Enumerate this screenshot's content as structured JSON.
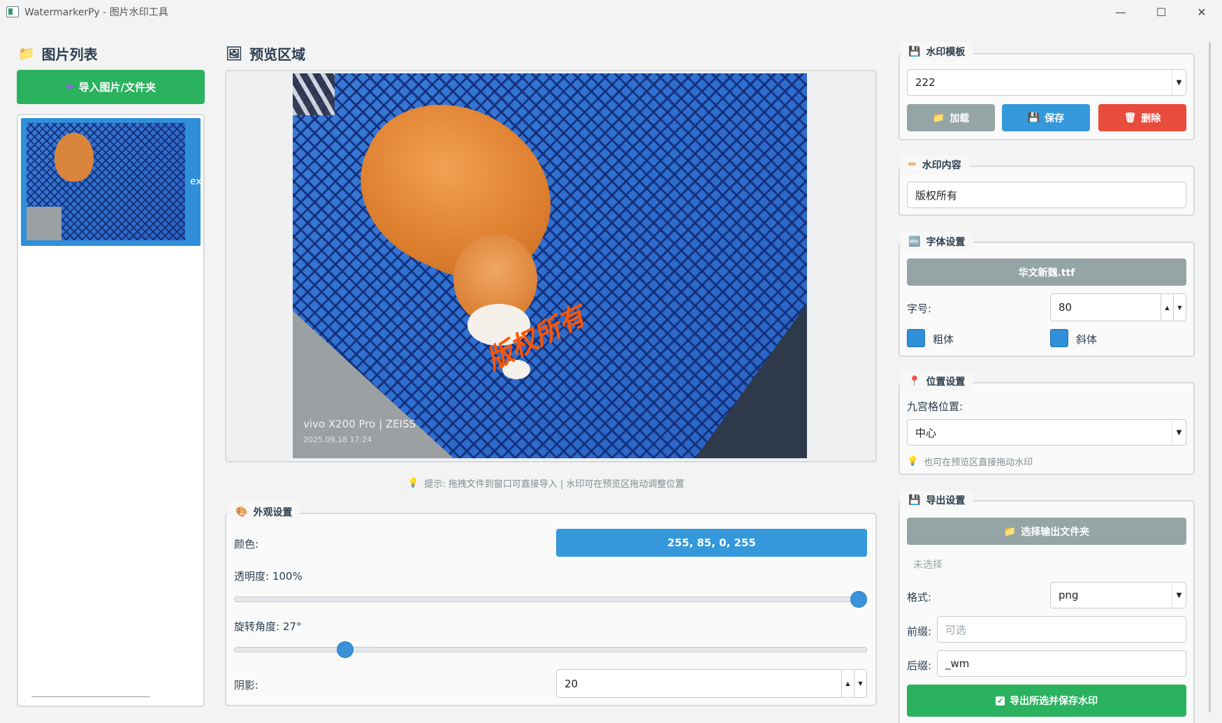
{
  "window": {
    "title": "WatermarkerPy - 图片水印工具"
  },
  "image_list": {
    "title": "图片列表",
    "import_button": "导入图片/文件夹",
    "item_text": "ex"
  },
  "preview": {
    "title": "预览区域",
    "watermark_text": "版权所有",
    "camera_caption": "vivo X200 Pro | ZEISS",
    "camera_date": "2025.09.18 17:24",
    "hint": "提示: 拖拽文件到窗口可直接导入 | 水印可在预览区拖动调整位置"
  },
  "appearance": {
    "group": "外观设置",
    "color_label": "颜色:",
    "color_value": "255, 85, 0, 255",
    "opacity_label": "透明度: 100%",
    "opacity_value": 1.0,
    "rotation_label": "旋转角度: 27°",
    "rotation_value": 27,
    "shadow_label": "阴影:",
    "shadow_value": "20"
  },
  "template": {
    "group": "水印模板",
    "selected": "222",
    "load_button": "加载",
    "save_button": "保存",
    "delete_button": "删除"
  },
  "content": {
    "group": "水印内容",
    "text": "版权所有"
  },
  "font": {
    "group": "字体设置",
    "font_button": "华文新魏.ttf",
    "size_label": "字号:",
    "size_value": "80",
    "bold_label": "粗体",
    "italic_label": "斜体"
  },
  "position": {
    "group": "位置设置",
    "grid_label": "九宫格位置:",
    "grid_value": "中心",
    "tip": "也可在预览区直接拖动水印"
  },
  "export": {
    "group": "导出设置",
    "folder_button": "选择输出文件夹",
    "folder_status": "未选择",
    "format_label": "格式:",
    "format_value": "png",
    "prefix_label": "前缀:",
    "prefix_placeholder": "可选",
    "suffix_label": "后缀:",
    "suffix_value": "_wm",
    "export_button": "导出所选并保存水印"
  },
  "colors": {
    "green": "#2ab25f",
    "blue": "#3498db",
    "red": "#e74c3c",
    "gray": "#95a5a6",
    "watermark": "#ff5500"
  }
}
